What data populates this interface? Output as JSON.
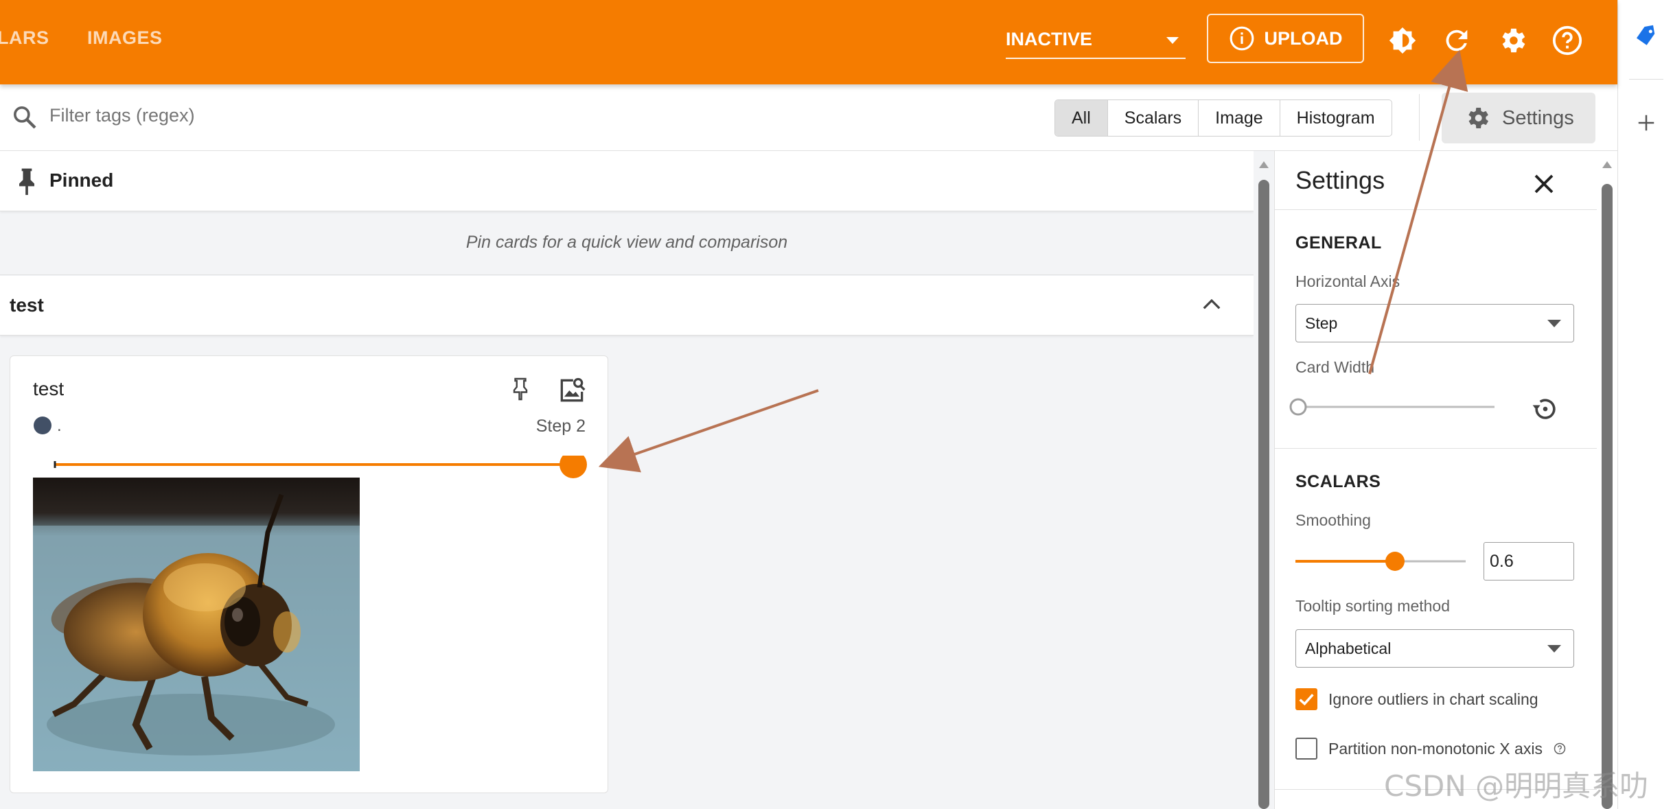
{
  "nav": {
    "tabs": [
      {
        "label": "ALARS"
      },
      {
        "label": "IMAGES"
      }
    ],
    "run_select_value": "INACTIVE",
    "upload_label": "UPLOAD",
    "icons": [
      "theme-toggle-icon",
      "refresh-icon",
      "settings-gear-icon",
      "help-icon"
    ]
  },
  "filter": {
    "placeholder": "Filter tags (regex)",
    "types": [
      "All",
      "Scalars",
      "Image",
      "Histogram"
    ],
    "active_type": "All",
    "settings_label": "Settings"
  },
  "pinned": {
    "title": "Pinned",
    "empty_text": "Pin cards for a quick view and comparison"
  },
  "group": {
    "title": "test"
  },
  "card": {
    "title": "test",
    "run_label": ".",
    "step_label": "Step 2",
    "step_position": 1.0
  },
  "settings": {
    "title": "Settings",
    "general": {
      "title": "GENERAL",
      "horizontal_axis_label": "Horizontal Axis",
      "horizontal_axis_value": "Step",
      "card_width_label": "Card Width",
      "card_width_position": 0.0
    },
    "scalars": {
      "title": "SCALARS",
      "smoothing_label": "Smoothing",
      "smoothing_value": "0.6",
      "smoothing_position": 0.6,
      "tooltip_label": "Tooltip sorting method",
      "tooltip_value": "Alphabetical",
      "ignore_outliers_label": "Ignore outliers in chart scaling",
      "ignore_outliers_checked": true,
      "partition_label": "Partition non-monotonic X axis",
      "partition_checked": false
    }
  },
  "colors": {
    "accent": "#f57c00",
    "run_dot": "#425066",
    "annotation_arrow": "#b87353"
  },
  "watermark": "CSDN @明明真系叻"
}
